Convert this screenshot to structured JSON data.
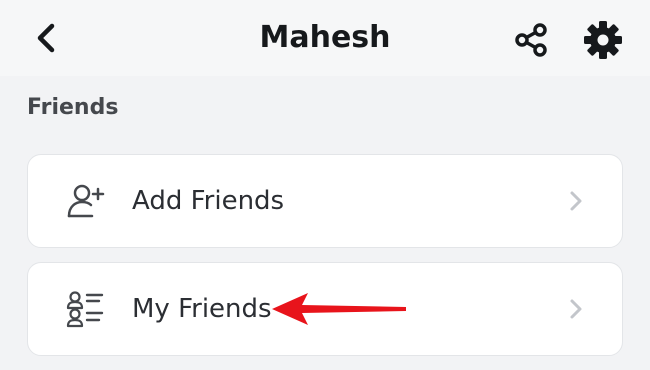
{
  "header": {
    "title": "Mahesh",
    "back_icon": "chevron-left-icon",
    "share_icon": "share-icon",
    "settings_icon": "gear-icon"
  },
  "friends_section": {
    "title": "Friends",
    "items": [
      {
        "label": "Add Friends",
        "icon": "add-friend-icon"
      },
      {
        "label": "My Friends",
        "icon": "friends-list-icon"
      }
    ]
  },
  "annotation": {
    "color": "#e8141b"
  }
}
